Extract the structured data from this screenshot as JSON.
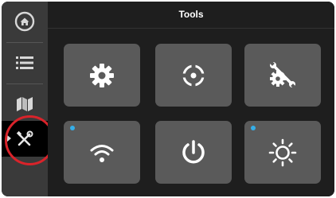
{
  "header": {
    "title": "Tools"
  },
  "sidebar": {
    "items": [
      {
        "name": "home",
        "icon": "home-icon",
        "active": false
      },
      {
        "name": "list",
        "icon": "list-icon",
        "active": false
      },
      {
        "name": "map",
        "icon": "map-icon",
        "active": false
      },
      {
        "name": "tools",
        "icon": "tools-icon",
        "active": true
      }
    ]
  },
  "tiles": [
    {
      "name": "settings",
      "icon": "gear-icon",
      "indicator": false
    },
    {
      "name": "gps",
      "icon": "gps-target-icon",
      "indicator": false
    },
    {
      "name": "service",
      "icon": "wrench-gear-icon",
      "indicator": false
    },
    {
      "name": "wifi",
      "icon": "wifi-icon",
      "indicator": true
    },
    {
      "name": "power",
      "icon": "power-icon",
      "indicator": false
    },
    {
      "name": "brightness",
      "icon": "sun-brightness-icon",
      "indicator": true
    }
  ],
  "colors": {
    "sidebar_bg": "#3a3a3a",
    "active_bg": "#000000",
    "tile_bg": "#5a5a5a",
    "indicator": "#35aee8",
    "highlight": "#d9232a"
  }
}
